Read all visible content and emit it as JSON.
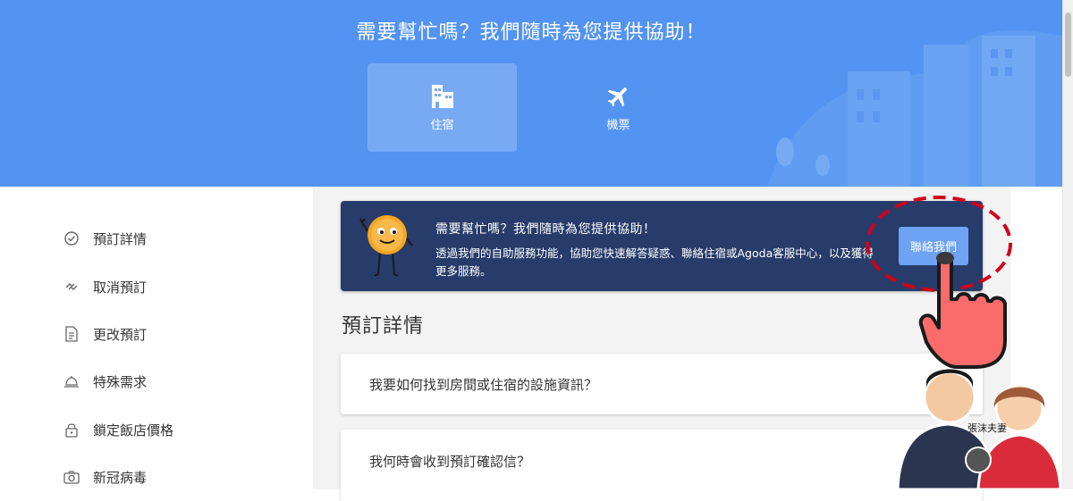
{
  "hero": {
    "title": "需要幫忙嗎？我們隨時為您提供協助！",
    "tabs": [
      {
        "label": "住宿",
        "icon": "building-icon",
        "active": true
      },
      {
        "label": "機票",
        "icon": "airplane-icon",
        "active": false
      }
    ],
    "color": "#5393f1"
  },
  "sidebar": {
    "items": [
      {
        "label": "預訂詳情",
        "icon": "check-circle-icon"
      },
      {
        "label": "取消預訂",
        "icon": "broken-link-icon"
      },
      {
        "label": "更改預訂",
        "icon": "document-icon"
      },
      {
        "label": "特殊需求",
        "icon": "bell-service-icon"
      },
      {
        "label": "鎖定飯店價格",
        "icon": "lock-icon"
      },
      {
        "label": "新冠病毒",
        "icon": "camera-icon"
      }
    ]
  },
  "banner": {
    "title": "需要幫忙嗎？我們隨時為您提供協助！",
    "description": "透過我們的自助服務功能，協助您快速解答疑惑、聯絡住宿或Agoda客服中心，以及獲得更多服務。",
    "button_label": "聯絡我們",
    "color": "#273c6a"
  },
  "section": {
    "title": "預訂詳情"
  },
  "faqs": [
    {
      "question": "我要如何找到房間或住宿的設施資訊？"
    },
    {
      "question": "我何時會收到預訂確認信？"
    }
  ],
  "watermark": {
    "text": "張沫夫妻"
  }
}
